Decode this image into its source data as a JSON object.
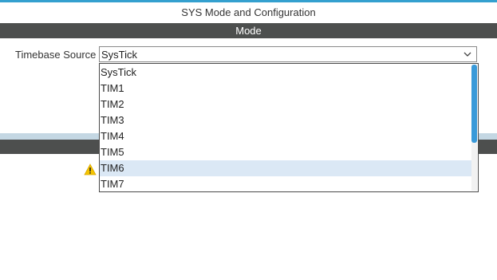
{
  "panel": {
    "title": "SYS Mode and Configuration",
    "mode_header": "Mode"
  },
  "timebase": {
    "label": "Timebase Source",
    "selected": "SysTick",
    "options": [
      "SysTick",
      "TIM1",
      "TIM2",
      "TIM3",
      "TIM4",
      "TIM5",
      "TIM6",
      "TIM7"
    ],
    "highlighted_option": "TIM6"
  },
  "icons": {
    "chevron": "chevron-down-icon",
    "warning": "warning-icon"
  },
  "colors": {
    "accent": "#34a0cf",
    "header_bar": "#4d4f4e",
    "highlight": "#dbe8f5",
    "scrollbar": "#3a9ad9",
    "warning": "#f5c400"
  }
}
